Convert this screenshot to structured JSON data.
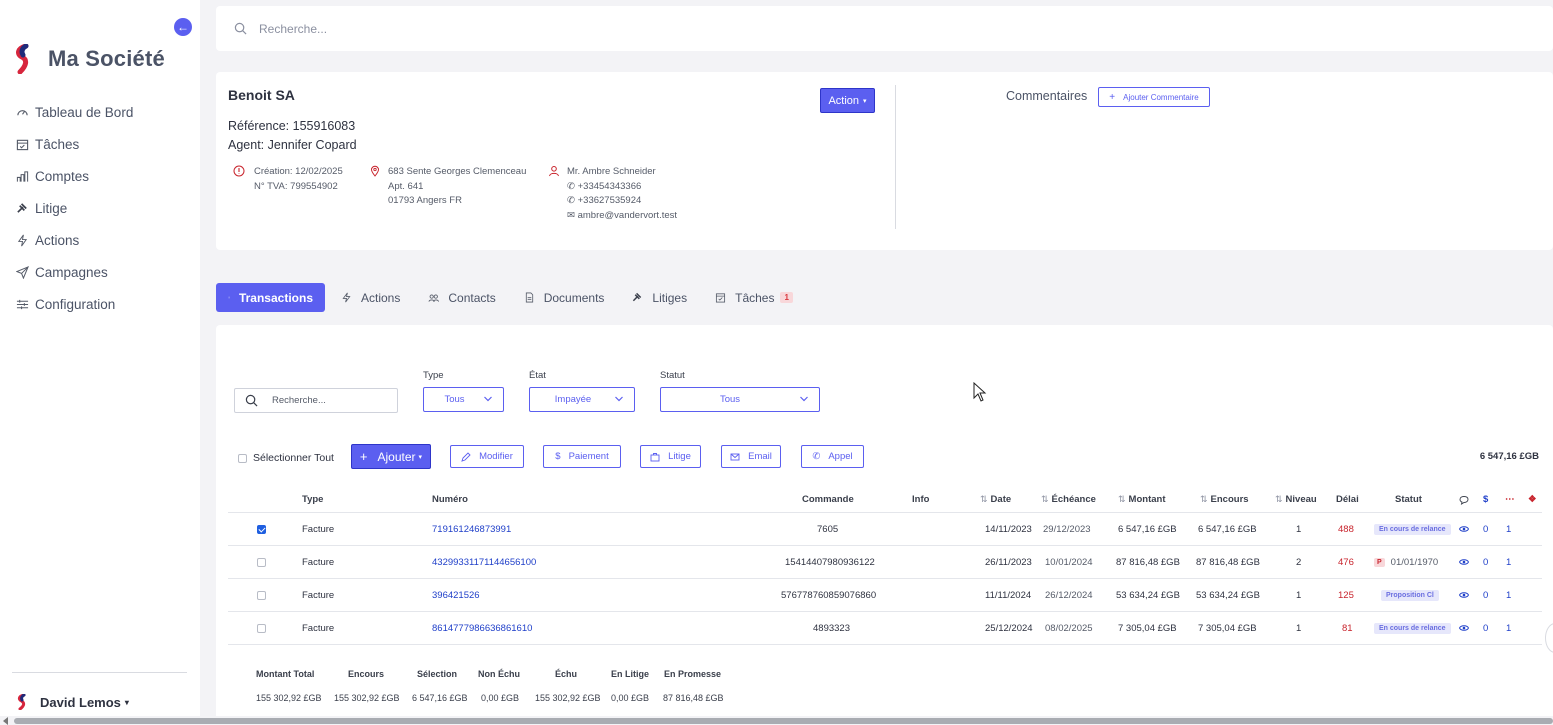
{
  "sidebar": {
    "brand": "Ma Société",
    "items": [
      {
        "label": "Tableau de Bord",
        "icon": "gauge-icon"
      },
      {
        "label": "Tâches",
        "icon": "calendar-check-icon"
      },
      {
        "label": "Comptes",
        "icon": "bar-chart-icon"
      },
      {
        "label": "Litige",
        "icon": "gavel-icon"
      },
      {
        "label": "Actions",
        "icon": "bolt-icon"
      },
      {
        "label": "Campagnes",
        "icon": "send-icon"
      },
      {
        "label": "Configuration",
        "icon": "sliders-icon"
      }
    ],
    "user": "David Lemos"
  },
  "topsearch": {
    "placeholder": "Recherche..."
  },
  "account": {
    "name": "Benoit SA",
    "reference": "Référence: 155916083",
    "agent": "Agent: Jennifer Copard",
    "action_label": "Action",
    "creation": "Création: 12/02/2025",
    "vat": "N° TVA: 799554902",
    "address_line1": "683 Sente Georges Clemenceau",
    "address_line2": "Apt. 641",
    "address_line3": "01793 Angers FR",
    "contact_name": "Mr. Ambre Schneider",
    "phone1": "+33454343366",
    "phone2": "+33627535924",
    "email": "ambre@vandervort.test",
    "comments_label": "Commentaires",
    "add_comment_label": "Ajouter Commentaire"
  },
  "tabs": [
    {
      "label": "Transactions",
      "icon": "list-icon",
      "active": true
    },
    {
      "label": "Actions",
      "icon": "bolt-icon"
    },
    {
      "label": "Contacts",
      "icon": "users-icon"
    },
    {
      "label": "Documents",
      "icon": "document-icon"
    },
    {
      "label": "Litiges",
      "icon": "gavel-icon"
    },
    {
      "label": "Tâches",
      "icon": "calendar-check-icon",
      "badge": "1"
    }
  ],
  "filters": {
    "search_placeholder": "Recherche...",
    "type_label": "Type",
    "type_value": "Tous",
    "etat_label": "État",
    "etat_value": "Impayée",
    "statut_label": "Statut",
    "statut_value": "Tous"
  },
  "toolbar": {
    "select_all": "Sélectionner Tout",
    "add": "Ajouter",
    "modify": "Modifier",
    "payment": "Paiement",
    "dispute": "Litige",
    "email": "Email",
    "call": "Appel",
    "total": "6 547,16 £GB"
  },
  "table": {
    "headers": {
      "type": "Type",
      "numero": "Numéro",
      "commande": "Commande",
      "info": "Info",
      "date": "Date",
      "echeance": "Échéance",
      "montant": "Montant",
      "encours": "Encours",
      "niveau": "Niveau",
      "delai": "Délai",
      "statut": "Statut"
    },
    "rows": [
      {
        "checked": true,
        "type": "Facture",
        "numero": "719161246873991",
        "commande": "7605",
        "date": "14/11/2023",
        "echeance": "29/12/2023",
        "montant": "6 547,16 £GB",
        "encours": "6 547,16 £GB",
        "niveau": "1",
        "delai": "488",
        "statut": "En cours de relance",
        "count1": "0",
        "count2": "1"
      },
      {
        "checked": false,
        "type": "Facture",
        "numero": "43299331171144656100",
        "commande": "15414407980936122",
        "date": "26/11/2023",
        "echeance": "10/01/2024",
        "montant": "87 816,48 £GB",
        "encours": "87 816,48 £GB",
        "niveau": "2",
        "delai": "476",
        "statut": "01/01/1970",
        "badge": "P",
        "count1": "0",
        "count2": "1"
      },
      {
        "checked": false,
        "type": "Facture",
        "numero": "396421526",
        "commande": "576778760859076860",
        "date": "11/11/2024",
        "echeance": "26/12/2024",
        "montant": "53 634,24 £GB",
        "encours": "53 634,24 £GB",
        "niveau": "1",
        "delai": "125",
        "statut": "Proposition Cl",
        "count1": "0",
        "count2": "1"
      },
      {
        "checked": false,
        "type": "Facture",
        "numero": "8614777986636861610",
        "commande": "4893323",
        "date": "25/12/2024",
        "echeance": "08/02/2025",
        "montant": "7 305,04 £GB",
        "encours": "7 305,04 £GB",
        "niveau": "1",
        "delai": "81",
        "statut": "En cours de relance",
        "count1": "0",
        "count2": "1"
      }
    ]
  },
  "summary": {
    "labels": [
      "Montant Total",
      "Encours",
      "Sélection",
      "Non Échu",
      "Échu",
      "En Litige",
      "En Promesse"
    ],
    "values": [
      "155 302,92 £GB",
      "155 302,92 £GB",
      "6 547,16 £GB",
      "0,00 £GB",
      "155 302,92 £GB",
      "0,00 £GB",
      "87 816,48 £GB"
    ]
  },
  "colors": {
    "accent": "#5b5ff0",
    "danger": "#c8232c",
    "link": "#1f3fc9"
  }
}
